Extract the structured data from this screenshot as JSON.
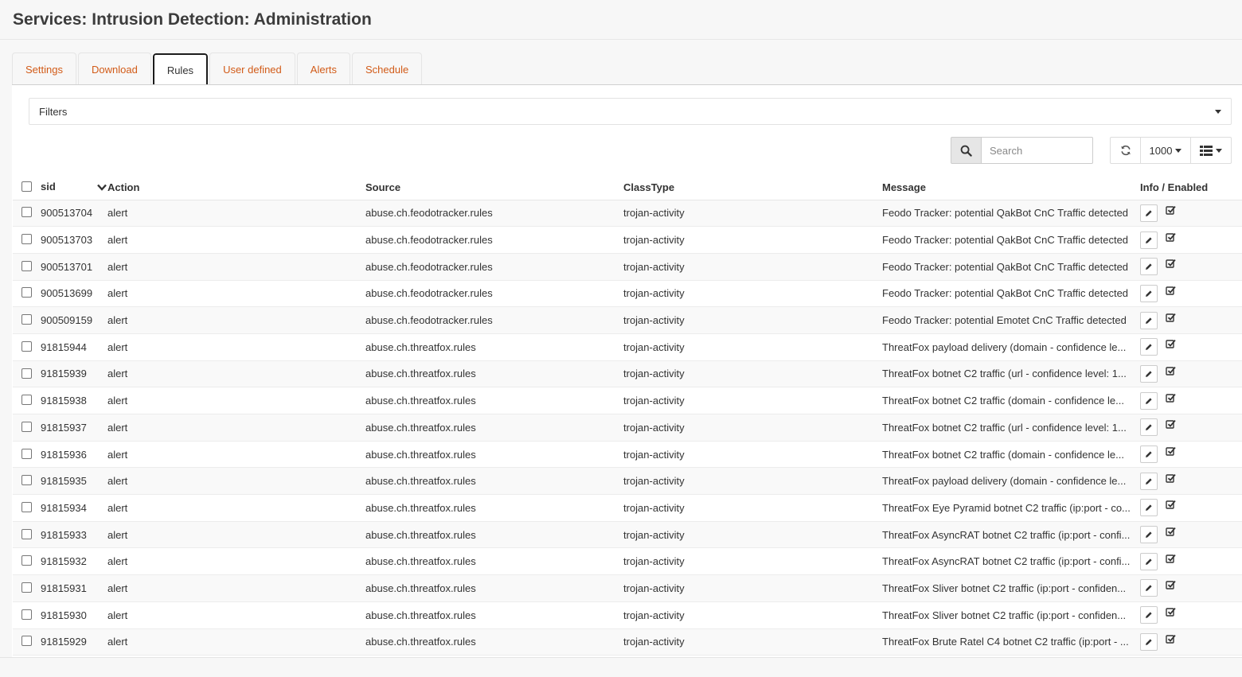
{
  "page": {
    "title": "Services: Intrusion Detection: Administration"
  },
  "tabs": [
    {
      "label": "Settings",
      "active": false
    },
    {
      "label": "Download",
      "active": false
    },
    {
      "label": "Rules",
      "active": true
    },
    {
      "label": "User defined",
      "active": false
    },
    {
      "label": "Alerts",
      "active": false
    },
    {
      "label": "Schedule",
      "active": false
    }
  ],
  "filters": {
    "label": "Filters"
  },
  "toolbar": {
    "search_placeholder": "Search",
    "page_size": "1000",
    "icons": [
      "search-icon",
      "refresh-icon",
      "columns-icon"
    ]
  },
  "table": {
    "columns": [
      "sid",
      "Action",
      "Source",
      "ClassType",
      "Message",
      "Info / Enabled"
    ],
    "rows": [
      {
        "sid": "900513704",
        "action": "alert",
        "source": "abuse.ch.feodotracker.rules",
        "classtype": "trojan-activity",
        "message": "Feodo Tracker: potential QakBot CnC Traffic detected"
      },
      {
        "sid": "900513703",
        "action": "alert",
        "source": "abuse.ch.feodotracker.rules",
        "classtype": "trojan-activity",
        "message": "Feodo Tracker: potential QakBot CnC Traffic detected"
      },
      {
        "sid": "900513701",
        "action": "alert",
        "source": "abuse.ch.feodotracker.rules",
        "classtype": "trojan-activity",
        "message": "Feodo Tracker: potential QakBot CnC Traffic detected"
      },
      {
        "sid": "900513699",
        "action": "alert",
        "source": "abuse.ch.feodotracker.rules",
        "classtype": "trojan-activity",
        "message": "Feodo Tracker: potential QakBot CnC Traffic detected"
      },
      {
        "sid": "900509159",
        "action": "alert",
        "source": "abuse.ch.feodotracker.rules",
        "classtype": "trojan-activity",
        "message": "Feodo Tracker: potential Emotet CnC Traffic detected"
      },
      {
        "sid": "91815944",
        "action": "alert",
        "source": "abuse.ch.threatfox.rules",
        "classtype": "trojan-activity",
        "message": "ThreatFox payload delivery (domain - confidence le..."
      },
      {
        "sid": "91815939",
        "action": "alert",
        "source": "abuse.ch.threatfox.rules",
        "classtype": "trojan-activity",
        "message": "ThreatFox botnet C2 traffic (url - confidence level: 1..."
      },
      {
        "sid": "91815938",
        "action": "alert",
        "source": "abuse.ch.threatfox.rules",
        "classtype": "trojan-activity",
        "message": "ThreatFox botnet C2 traffic (domain - confidence le..."
      },
      {
        "sid": "91815937",
        "action": "alert",
        "source": "abuse.ch.threatfox.rules",
        "classtype": "trojan-activity",
        "message": "ThreatFox botnet C2 traffic (url - confidence level: 1..."
      },
      {
        "sid": "91815936",
        "action": "alert",
        "source": "abuse.ch.threatfox.rules",
        "classtype": "trojan-activity",
        "message": "ThreatFox botnet C2 traffic (domain - confidence le..."
      },
      {
        "sid": "91815935",
        "action": "alert",
        "source": "abuse.ch.threatfox.rules",
        "classtype": "trojan-activity",
        "message": "ThreatFox payload delivery (domain - confidence le..."
      },
      {
        "sid": "91815934",
        "action": "alert",
        "source": "abuse.ch.threatfox.rules",
        "classtype": "trojan-activity",
        "message": "ThreatFox Eye Pyramid botnet C2 traffic (ip:port - co..."
      },
      {
        "sid": "91815933",
        "action": "alert",
        "source": "abuse.ch.threatfox.rules",
        "classtype": "trojan-activity",
        "message": "ThreatFox AsyncRAT botnet C2 traffic (ip:port - confi..."
      },
      {
        "sid": "91815932",
        "action": "alert",
        "source": "abuse.ch.threatfox.rules",
        "classtype": "trojan-activity",
        "message": "ThreatFox AsyncRAT botnet C2 traffic (ip:port - confi..."
      },
      {
        "sid": "91815931",
        "action": "alert",
        "source": "abuse.ch.threatfox.rules",
        "classtype": "trojan-activity",
        "message": "ThreatFox Sliver botnet C2 traffic (ip:port - confiden..."
      },
      {
        "sid": "91815930",
        "action": "alert",
        "source": "abuse.ch.threatfox.rules",
        "classtype": "trojan-activity",
        "message": "ThreatFox Sliver botnet C2 traffic (ip:port - confiden..."
      },
      {
        "sid": "91815929",
        "action": "alert",
        "source": "abuse.ch.threatfox.rules",
        "classtype": "trojan-activity",
        "message": "ThreatFox Brute Ratel C4 botnet C2 traffic (ip:port - ..."
      }
    ]
  },
  "colors": {
    "accent": "#d25b18",
    "text": "#333333",
    "stripe": "#f9f9f9"
  }
}
